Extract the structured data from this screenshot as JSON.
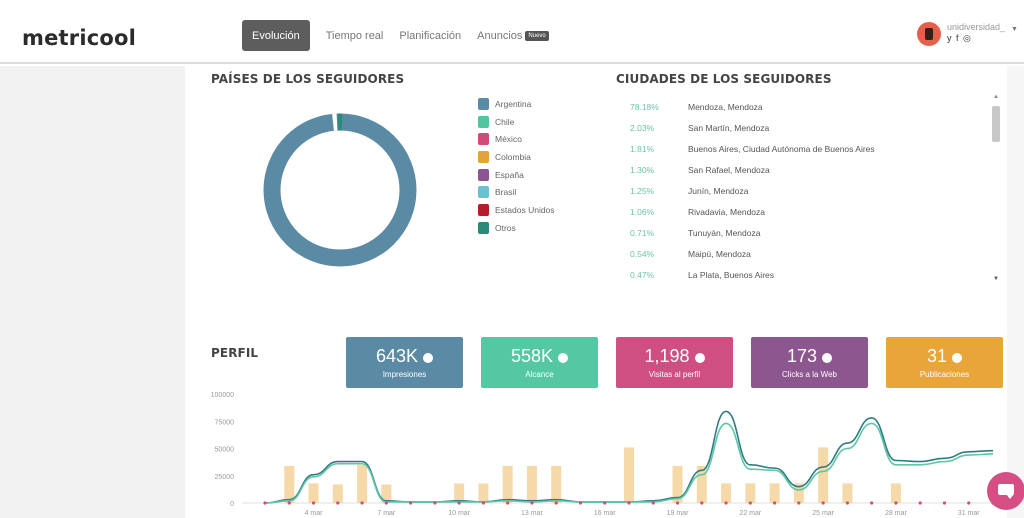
{
  "header": {
    "logo": "metricool",
    "nav": [
      {
        "label": "Evolución",
        "active": true
      },
      {
        "label": "Tiempo real"
      },
      {
        "label": "Planificación"
      },
      {
        "label": "Anuncios",
        "badge": "Nuevo"
      }
    ],
    "user": {
      "name": "unidiversidad_",
      "social": "y f ◎"
    }
  },
  "countries": {
    "title": "PAÍSES DE LOS SEGUIDORES",
    "legend": [
      {
        "label": "Argentina",
        "color": "#5b8ba4"
      },
      {
        "label": "Chile",
        "color": "#51c4a0"
      },
      {
        "label": "México",
        "color": "#d04a7a"
      },
      {
        "label": "Colombia",
        "color": "#e2a33b"
      },
      {
        "label": "España",
        "color": "#8a5590"
      },
      {
        "label": "Brasil",
        "color": "#6ac2d1"
      },
      {
        "label": "Estados Unidos",
        "color": "#b21f2a"
      },
      {
        "label": "Otros",
        "color": "#2c8a78"
      }
    ]
  },
  "cities": {
    "title": "CIUDADES DE LOS SEGUIDORES",
    "rows": [
      {
        "pct": "78.18%",
        "name": "Mendoza, Mendoza"
      },
      {
        "pct": "2.03%",
        "name": "San Martín, Mendoza"
      },
      {
        "pct": "1.81%",
        "name": "Buenos Aires, Ciudad Autónoma de Buenos Aires"
      },
      {
        "pct": "1.30%",
        "name": "San Rafael, Mendoza"
      },
      {
        "pct": "1.25%",
        "name": "Junín, Mendoza"
      },
      {
        "pct": "1.06%",
        "name": "Rivadavia, Mendoza"
      },
      {
        "pct": "0.71%",
        "name": "Tunuyán, Mendoza"
      },
      {
        "pct": "0.54%",
        "name": "Maipú, Mendoza"
      },
      {
        "pct": "0.47%",
        "name": "La Plata, Buenos Aires"
      }
    ]
  },
  "perfil": {
    "title": "PERFIL",
    "cards": [
      {
        "value": "643K",
        "label": "Impresiones",
        "color": "#5b8ba4",
        "trend": "down"
      },
      {
        "value": "558K",
        "label": "Alcance",
        "color": "#55c8a3",
        "trend": "down"
      },
      {
        "value": "1,198",
        "label": "Visitas al perfil",
        "color": "#d04f82",
        "trend": "down"
      },
      {
        "value": "173",
        "label": "Clicks a la Web",
        "color": "#8c578e",
        "trend": "down"
      },
      {
        "value": "31",
        "label": "Publicaciones",
        "color": "#e7a53a",
        "trend": "up"
      }
    ]
  },
  "chart_data": {
    "type": "bar",
    "y_ticks": [
      "100000",
      "75000",
      "50000",
      "25000",
      "0"
    ],
    "x_tick_labels": [
      "4 mar",
      "7 mar",
      "10 mar",
      "13 mar",
      "16 mar",
      "19 mar",
      "22 mar",
      "25 mar",
      "28 mar",
      "31 mar"
    ],
    "ylim": [
      0,
      100000
    ],
    "series": [
      {
        "kind": "bar",
        "color": "#f6d9a9",
        "values": [
          0,
          34000,
          18000,
          17000,
          35000,
          17000,
          0,
          0,
          18000,
          18000,
          34000,
          34000,
          34000,
          0,
          0,
          51000,
          0,
          34000,
          34000,
          18000,
          18000,
          18000,
          18000,
          51000,
          18000,
          0,
          18000,
          0,
          0,
          0,
          0
        ]
      },
      {
        "kind": "line",
        "color": "#2f7c86",
        "values": [
          0,
          3000,
          26000,
          38000,
          38000,
          2000,
          1000,
          1000,
          2000,
          1000,
          3000,
          2000,
          3000,
          1000,
          1000,
          1000,
          2000,
          5000,
          30000,
          84000,
          35000,
          32000,
          15000,
          33000,
          55000,
          78000,
          39000,
          38000,
          41000,
          47000,
          48000
        ]
      },
      {
        "kind": "line",
        "color": "#5fc7a5",
        "values": [
          0,
          2000,
          24000,
          36000,
          36000,
          1000,
          1000,
          1000,
          1000,
          1000,
          2000,
          1000,
          2000,
          1000,
          1000,
          1000,
          1000,
          4000,
          26000,
          73000,
          31000,
          30000,
          12000,
          29000,
          50000,
          73000,
          35000,
          35000,
          38000,
          44000,
          45000
        ]
      }
    ]
  }
}
